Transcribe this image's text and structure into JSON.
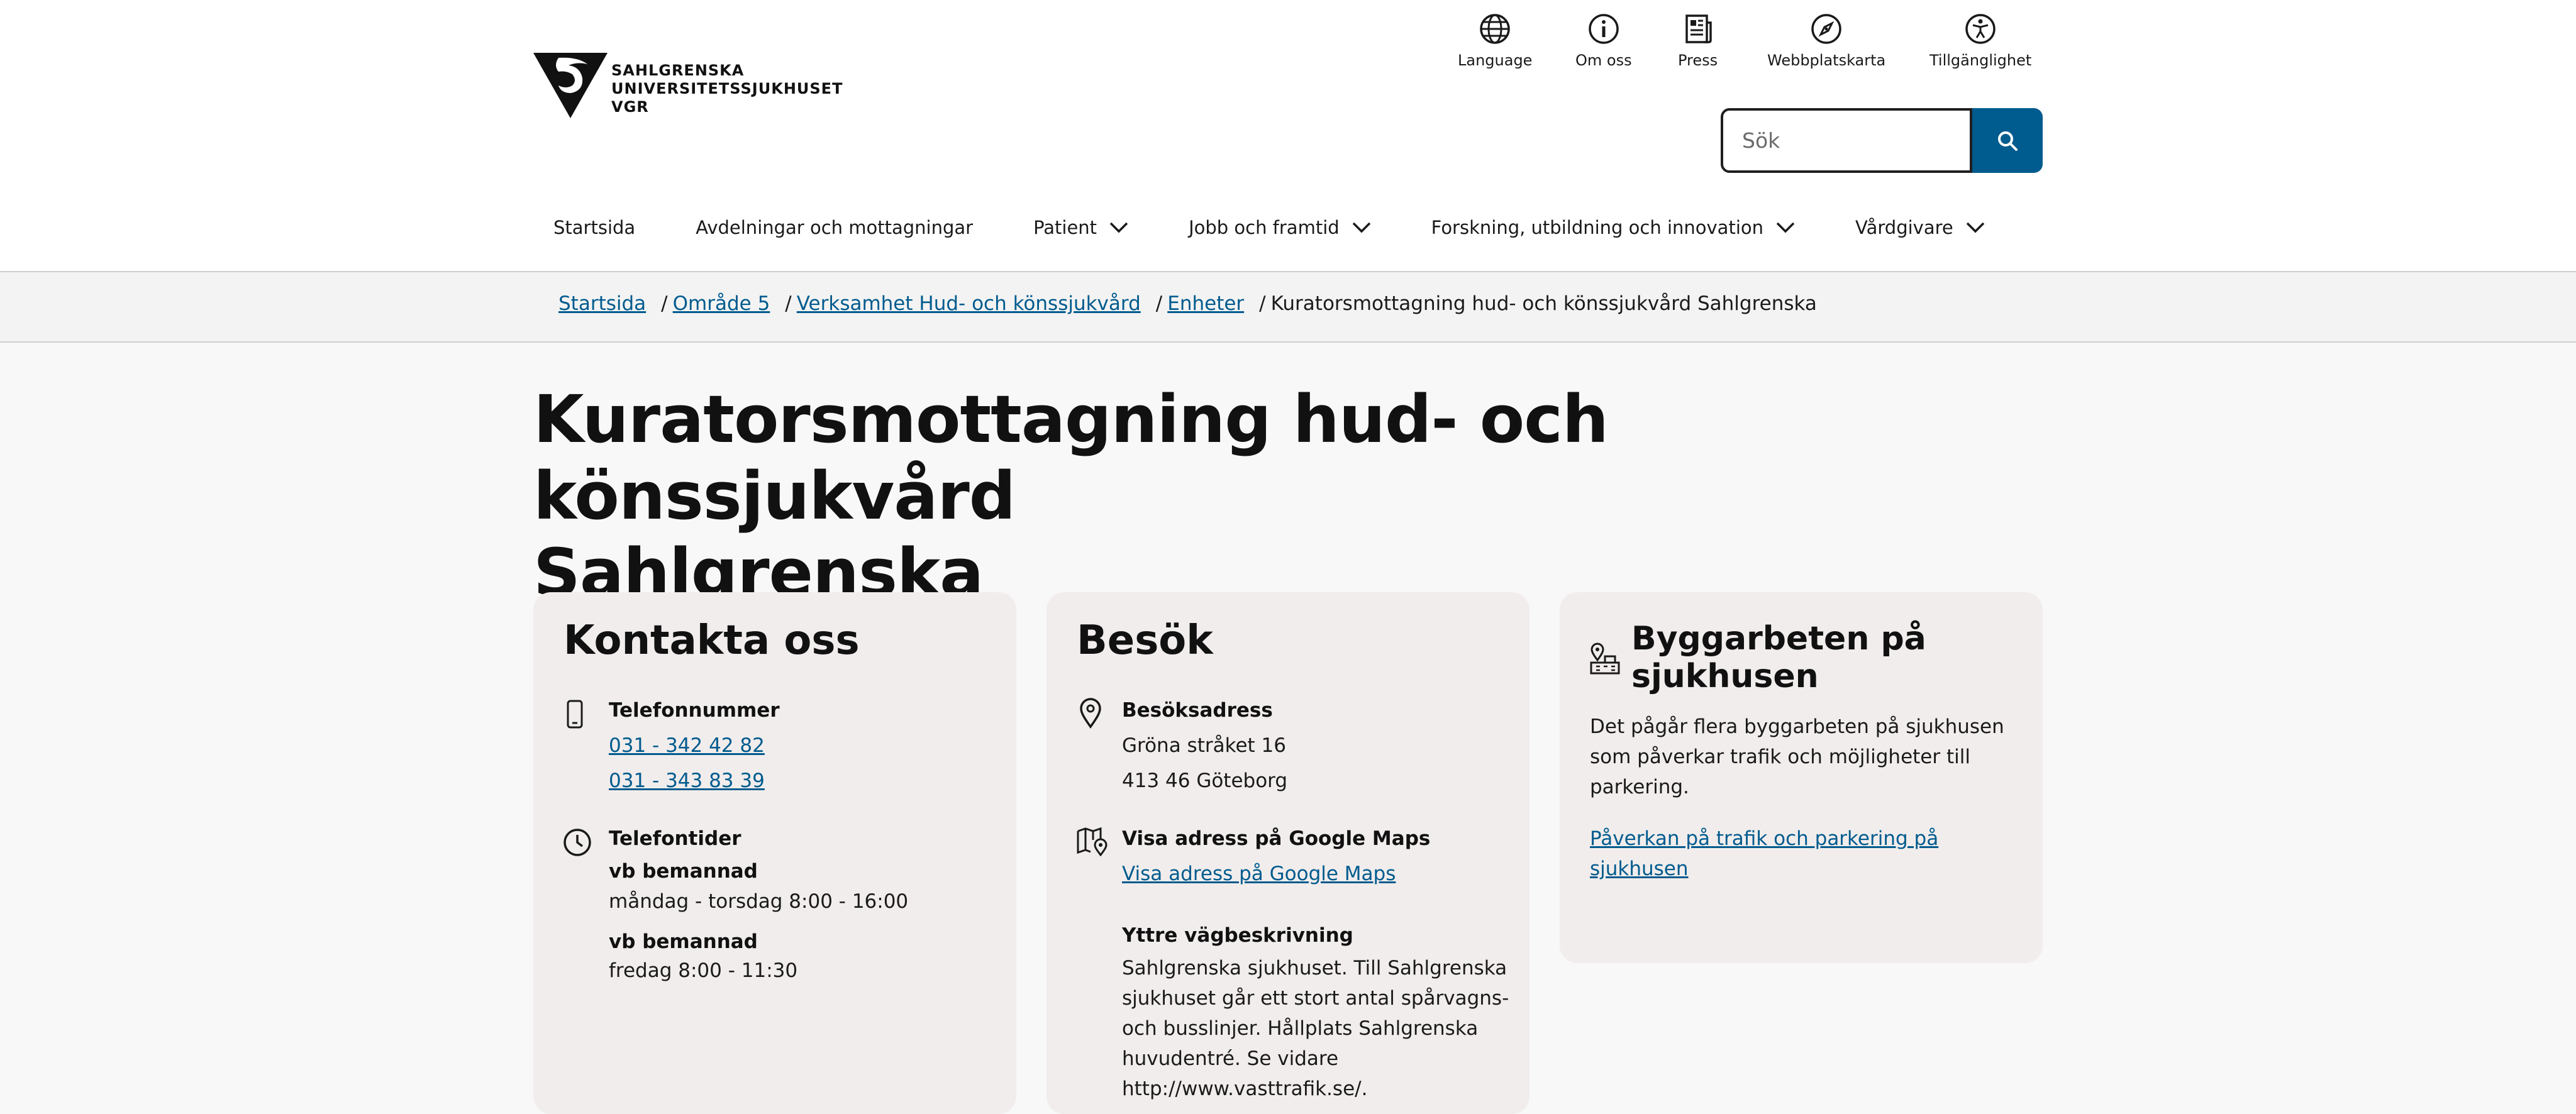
{
  "logo": {
    "line1": "SAHLGRENSKA",
    "line2": "UNIVERSITETSSJUKHUSET",
    "line3": "VGR"
  },
  "utility": {
    "language": "Language",
    "about": "Om oss",
    "press": "Press",
    "sitemap": "Webbplatskarta",
    "accessibility": "Tillgänglighet"
  },
  "search": {
    "placeholder": "Sök"
  },
  "nav": {
    "items": [
      {
        "label": "Startsida"
      },
      {
        "label": "Avdelningar och mottagningar"
      },
      {
        "label": "Patient"
      },
      {
        "label": "Jobb och framtid"
      },
      {
        "label": "Forskning, utbildning och innovation"
      },
      {
        "label": "Vårdgivare"
      }
    ]
  },
  "breadcrumb": {
    "items": [
      "Startsida",
      "Område 5",
      "Verksamhet Hud- och könssjukvård",
      "Enheter"
    ],
    "current": "Kuratorsmottagning hud- och könssjukvård Sahlgrenska"
  },
  "page": {
    "title_line1": "Kuratorsmottagning hud- och könssjukvård",
    "title_line2": "Sahlgrenska"
  },
  "contact": {
    "heading": "Kontakta oss",
    "phone_label": "Telefonnummer",
    "phone1": "031 - 342 42 82",
    "phone2": "031 - 343 83 39",
    "hours_label": "Telefontider",
    "hours1_title": "vb bemannad",
    "hours1_time": "måndag - torsdag 8:00 - 16:00",
    "hours2_title": "vb bemannad",
    "hours2_time": "fredag 8:00 - 11:30"
  },
  "visit": {
    "heading": "Besök",
    "address_label": "Besöksadress",
    "street": "Gröna stråket 16",
    "city": "413 46 Göteborg",
    "maps_label": "Visa adress på Google Maps",
    "maps_link": "Visa adress på Google Maps",
    "directions_label": "Yttre vägbeskrivning",
    "directions_l1": "Sahlgrenska sjukhuset. Till Sahlgrenska",
    "directions_l2": "sjukhuset går ett stort antal spårvagns-",
    "directions_l3": "och busslinjer. Hållplats Sahlgrenska",
    "directions_l4": "huvudentré. Se vidare",
    "directions_l5": "http://www.vasttrafik.se/."
  },
  "construction": {
    "heading_line1": "Byggarbeten på",
    "heading_line2": "sjukhusen",
    "text_l1": "Det pågår flera byggarbeten på sjukhusen",
    "text_l2": "som påverkar trafik och möjligheter till",
    "text_l3": "parkering.",
    "link_l1": "Påverkan på trafik och parkering på",
    "link_l2": "sjukhusen"
  },
  "colors": {
    "accent": "#005b8e",
    "card_bg": "#f1edec",
    "page_bg": "#f8f8f8"
  }
}
